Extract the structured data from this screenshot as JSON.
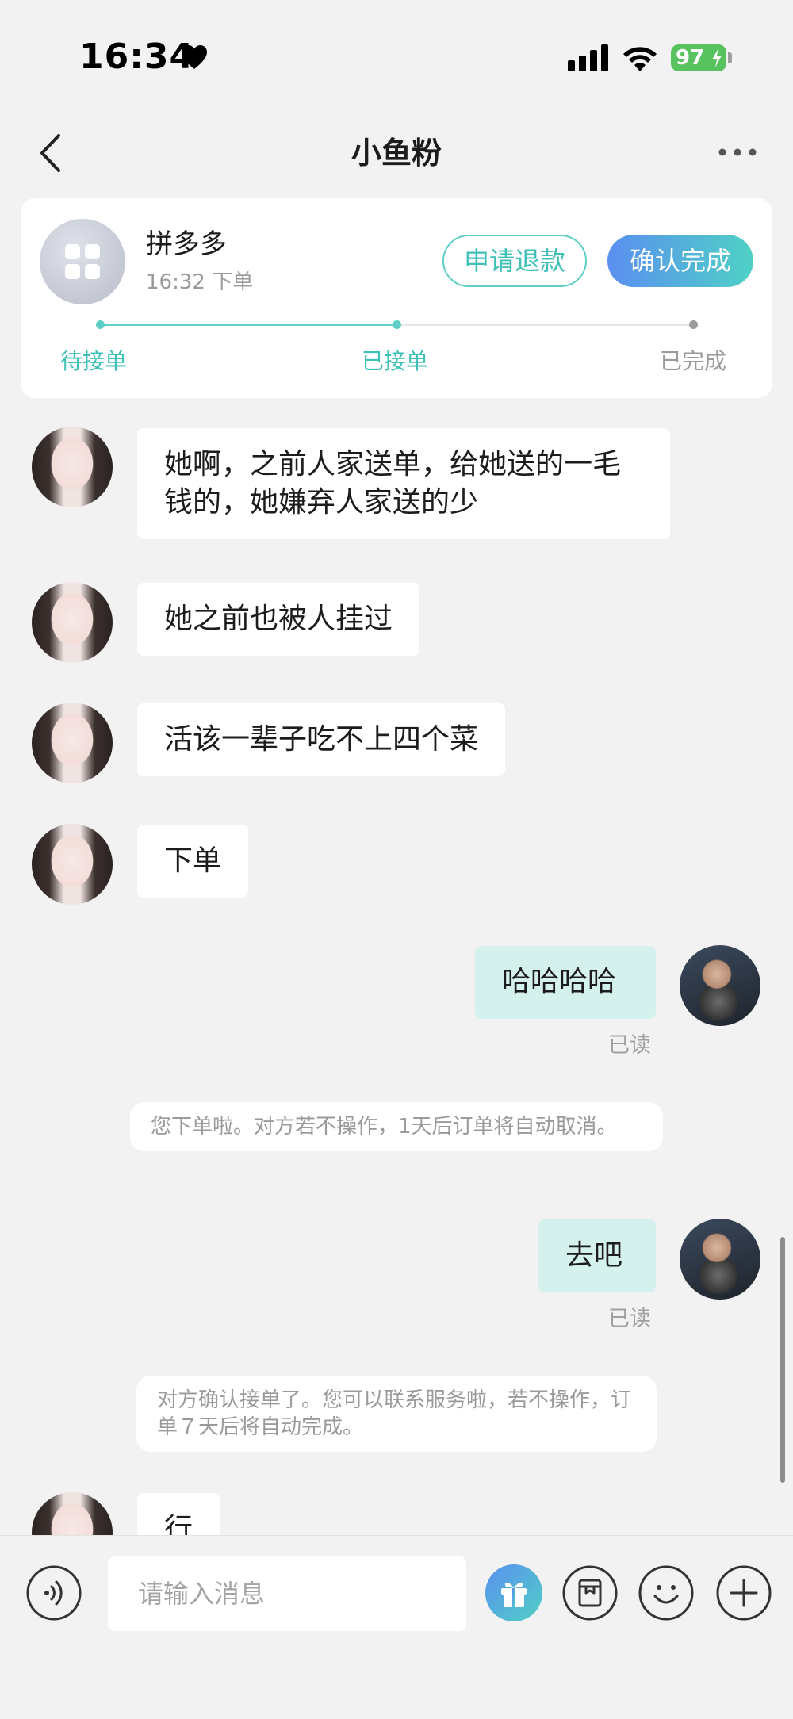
{
  "status_bar": {
    "time": "16:34",
    "battery": "97"
  },
  "nav": {
    "title": "小鱼粉"
  },
  "order": {
    "shop_name": "拼多多",
    "order_time": "16:32 下单",
    "refund_label": "申请退款",
    "confirm_label": "确认完成",
    "progress_steps": [
      {
        "label": "待接单",
        "done": true
      },
      {
        "label": "已接单",
        "done": true
      },
      {
        "label": "已完成",
        "done": false
      }
    ]
  },
  "messages": {
    "m1": "她啊，之前人家送单，给她送的一毛钱的，她嫌弃人家送的少",
    "m2": "她之前也被人挂过",
    "m3": "活该一辈子吃不上四个菜",
    "m4": "下单",
    "m5": "哈哈哈哈",
    "m5_status": "已读",
    "s1": "您下单啦。对方若不操作，1天后订单将自动取消。",
    "m6": "去吧",
    "m6_status": "已读",
    "s2": "对方确认接单了。您可以联系服务啦，若不操作，订单７天后将自动完成。",
    "m7": "行"
  },
  "input": {
    "placeholder": "请输入消息"
  },
  "icons": {
    "back": "chevron-left-icon",
    "more": "more-dots-icon",
    "voice": "voice-icon",
    "gift": "gift-icon",
    "order": "order-box-icon",
    "emoji": "emoji-icon",
    "plus": "plus-icon"
  },
  "colors": {
    "accent": "#4fd1c5",
    "confirm_gradient_start": "#5a8ff0",
    "outgoing_bubble": "#d5f1ee",
    "battery": "#58c25f"
  }
}
